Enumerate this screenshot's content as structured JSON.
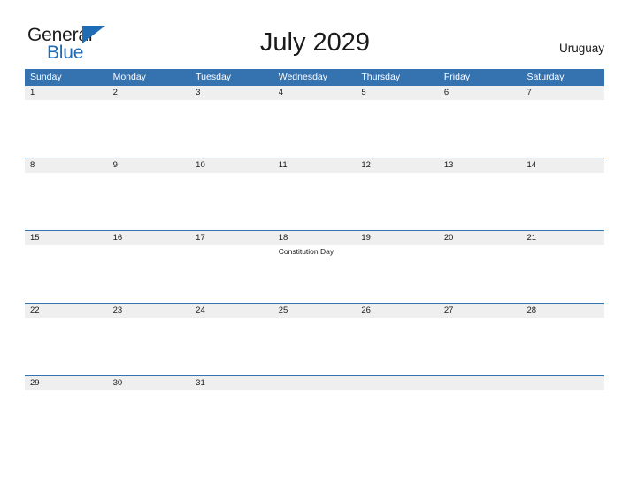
{
  "brand": {
    "name_part1": "General",
    "name_part2": "Blue",
    "primary_color": "#1f6cb5"
  },
  "header": {
    "title": "July 2029",
    "country": "Uruguay"
  },
  "calendar": {
    "header_color": "#3572b0",
    "date_strip_color": "#efefef",
    "weekdays": [
      "Sunday",
      "Monday",
      "Tuesday",
      "Wednesday",
      "Thursday",
      "Friday",
      "Saturday"
    ],
    "weeks": [
      {
        "days": [
          {
            "date": "1",
            "event": ""
          },
          {
            "date": "2",
            "event": ""
          },
          {
            "date": "3",
            "event": ""
          },
          {
            "date": "4",
            "event": ""
          },
          {
            "date": "5",
            "event": ""
          },
          {
            "date": "6",
            "event": ""
          },
          {
            "date": "7",
            "event": ""
          }
        ]
      },
      {
        "days": [
          {
            "date": "8",
            "event": ""
          },
          {
            "date": "9",
            "event": ""
          },
          {
            "date": "10",
            "event": ""
          },
          {
            "date": "11",
            "event": ""
          },
          {
            "date": "12",
            "event": ""
          },
          {
            "date": "13",
            "event": ""
          },
          {
            "date": "14",
            "event": ""
          }
        ]
      },
      {
        "days": [
          {
            "date": "15",
            "event": ""
          },
          {
            "date": "16",
            "event": ""
          },
          {
            "date": "17",
            "event": ""
          },
          {
            "date": "18",
            "event": "Constitution Day"
          },
          {
            "date": "19",
            "event": ""
          },
          {
            "date": "20",
            "event": ""
          },
          {
            "date": "21",
            "event": ""
          }
        ]
      },
      {
        "days": [
          {
            "date": "22",
            "event": ""
          },
          {
            "date": "23",
            "event": ""
          },
          {
            "date": "24",
            "event": ""
          },
          {
            "date": "25",
            "event": ""
          },
          {
            "date": "26",
            "event": ""
          },
          {
            "date": "27",
            "event": ""
          },
          {
            "date": "28",
            "event": ""
          }
        ]
      },
      {
        "days": [
          {
            "date": "29",
            "event": ""
          },
          {
            "date": "30",
            "event": ""
          },
          {
            "date": "31",
            "event": ""
          },
          {
            "date": "",
            "event": ""
          },
          {
            "date": "",
            "event": ""
          },
          {
            "date": "",
            "event": ""
          },
          {
            "date": "",
            "event": ""
          }
        ]
      }
    ]
  }
}
